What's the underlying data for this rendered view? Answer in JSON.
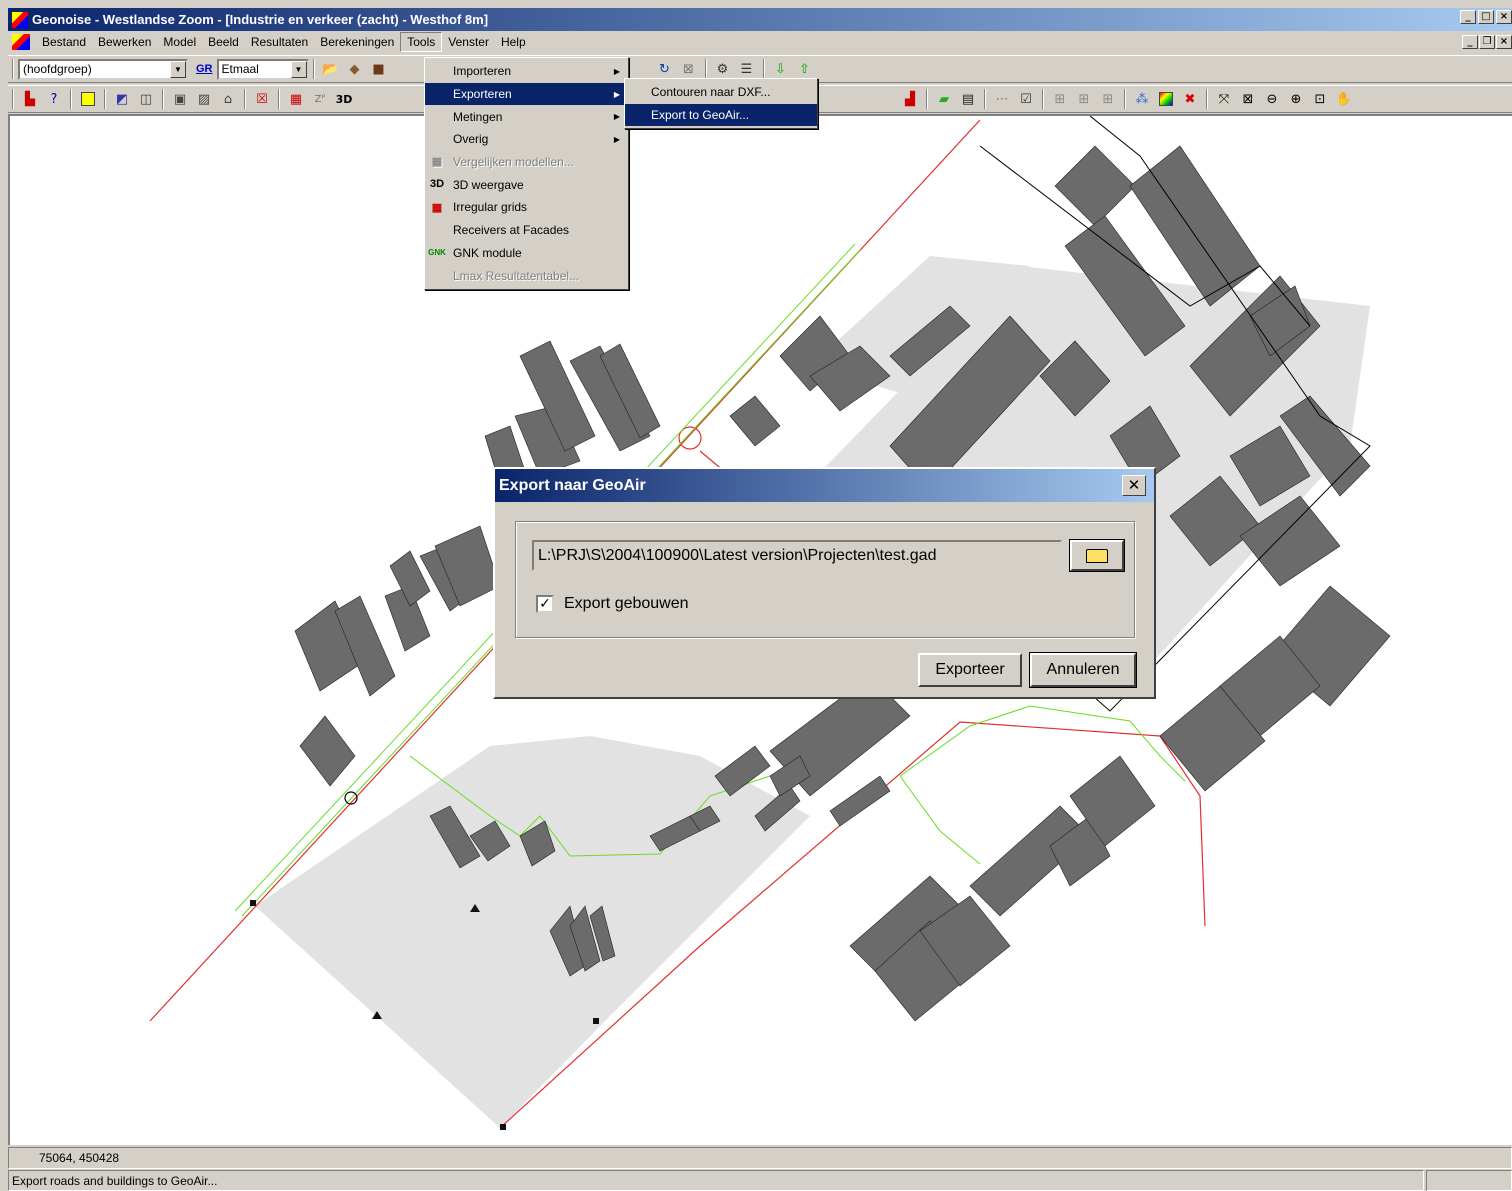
{
  "window": {
    "title": "Geonoise - Westlandse Zoom - [Industrie en verkeer (zacht) - Westhof 8m]"
  },
  "menubar": {
    "items": [
      "Bestand",
      "Bewerken",
      "Model",
      "Beeld",
      "Resultaten",
      "Berekeningen",
      "Tools",
      "Venster",
      "Help"
    ]
  },
  "toolbar": {
    "group_combo": "(hoofdgroep)",
    "gr_label": "GR",
    "period_combo": "Etmaal"
  },
  "tools_menu": {
    "items": [
      {
        "label": "Importeren",
        "submenu": true,
        "state": "normal",
        "icon": ""
      },
      {
        "label": "Exporteren",
        "submenu": true,
        "state": "highlighted",
        "icon": ""
      },
      {
        "label": "Metingen",
        "submenu": true,
        "state": "normal",
        "icon": ""
      },
      {
        "label": "Overig",
        "submenu": true,
        "state": "normal",
        "icon": ""
      },
      {
        "label": "Vergelijken modellen...",
        "submenu": false,
        "state": "disabled",
        "icon": "grid-icon"
      },
      {
        "label": "3D weergave",
        "submenu": false,
        "state": "normal",
        "icon": "3d-icon"
      },
      {
        "label": "Irregular grids",
        "submenu": false,
        "state": "normal",
        "icon": "irregular-grid-icon"
      },
      {
        "label": "Receivers at Facades",
        "submenu": false,
        "state": "normal",
        "icon": ""
      },
      {
        "label": "GNK module",
        "submenu": false,
        "state": "normal",
        "icon": "gnk-icon"
      },
      {
        "label": "Lmax Resultatentabel...",
        "submenu": false,
        "state": "disabled",
        "icon": ""
      }
    ]
  },
  "export_submenu": {
    "items": [
      {
        "label": "Contouren naar DXF...",
        "state": "normal"
      },
      {
        "label": "Export to GeoAir...",
        "state": "highlighted"
      }
    ]
  },
  "dialog": {
    "title": "Export naar GeoAir",
    "close": "✕",
    "path": "L:\\PRJ\\S\\2004\\100900\\Latest version\\Projecten\\test.gad",
    "checkbox_label": "Export gebouwen",
    "checkbox_checked": true,
    "export_button": "Exporteer",
    "cancel_button": "Annuleren"
  },
  "status": {
    "coordinates": "75064, 450428",
    "message": "Export roads and buildings to GeoAir..."
  },
  "colors": {
    "title_start": "#0a246a",
    "title_end": "#a6caf0",
    "face": "#d4d0c8",
    "highlight": "#0a246a",
    "building": "#6b6b6b",
    "ground": "#e2e2e2",
    "road": "#e03030",
    "line": "#66dd22"
  }
}
